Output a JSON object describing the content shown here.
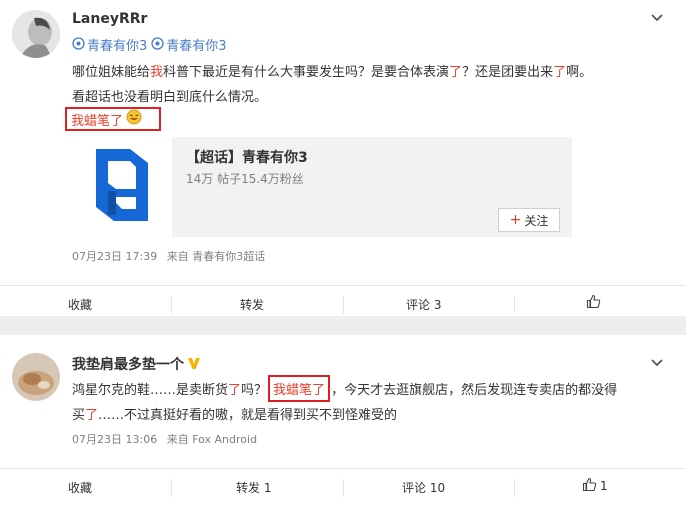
{
  "post1": {
    "username": "LaneyRRr",
    "topic_1": "青春有你3",
    "topic_2": "青春有你3",
    "text_p1": "哪位姐妹能给",
    "text_r1": "我",
    "text_p2": "科普下最近是有什么大事要发生吗？是要合体表演",
    "text_r2": "了",
    "text_p3": "？还是团要出来",
    "text_r3": "了",
    "text_p4": "啊。",
    "line2": "看超话也没看明白到底什么情况。",
    "highlight": "我蜡笔了",
    "card_title": "【超话】青春有你3",
    "card_stats": "14万 帖子15.4万粉丝",
    "follow_label": "关注",
    "time": "07月23日 17:39",
    "source": "来自 青春有你3超话",
    "actions": {
      "collect": "收藏",
      "repost": "转发",
      "comment": "评论 3",
      "like": ""
    }
  },
  "post2": {
    "username": "我垫肩最多垫一个",
    "t1": "鸿星尔克的鞋……是卖断货",
    "t1r": "了",
    "t2": "吗？",
    "highlight": "我蜡笔了",
    "t3": "，今天才去逛旗舰店，然后发现连专卖店的都没得",
    "l2a": "买",
    "l2r": "了",
    "l2b": "……不过真挺好看的嗷，就是看得到买不到怪难受的",
    "time": "07月23日 13:06",
    "source": "来自 Fox Android",
    "actions": {
      "collect": "收藏",
      "repost": "转发 1",
      "comment": "评论 10",
      "like": "1"
    }
  },
  "colors": {
    "accent_red": "#e8402c",
    "topic_blue": "#4a7cc7",
    "vip_gold": "#f5b400",
    "logo_blue": "#1668d6"
  },
  "icons": [
    "chevron-down-icon",
    "topic-icon",
    "vip-badge-icon",
    "laugh-emoji-icon",
    "plus-icon",
    "thumbs-up-icon"
  ]
}
